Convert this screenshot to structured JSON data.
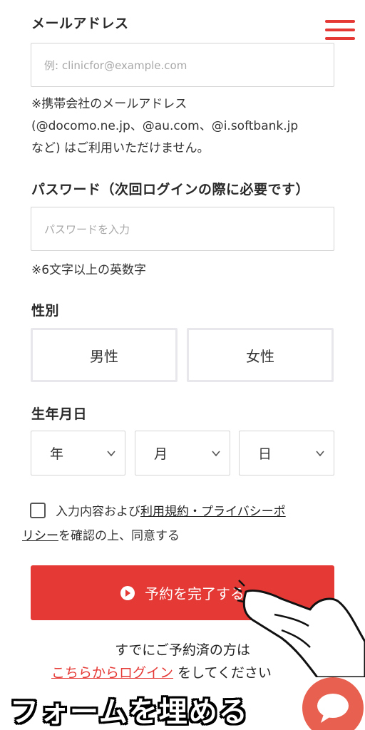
{
  "email": {
    "label": "メールアドレス",
    "placeholder": "例: clinicfor@example.com",
    "note_line1": "※携帯会社のメールアドレス",
    "note_line2": "(@docomo.ne.jp、@au.com、@i.softbank.jp",
    "note_line3": "など) はご利用いただけません。"
  },
  "password": {
    "label": "パスワード（次回ログインの際に必要です）",
    "placeholder": "パスワードを入力",
    "note": "※6文字以上の英数字"
  },
  "gender": {
    "label": "性別",
    "options": [
      "男性",
      "女性"
    ]
  },
  "birthdate": {
    "label": "生年月日",
    "year": "年",
    "month": "月",
    "day": "日"
  },
  "agreement": {
    "prefix": "入力内容および",
    "link_part1": "利用規約・プライバシーポ",
    "link_part2": "リシー",
    "suffix": "を確認の上、同意する"
  },
  "submit": {
    "label": "予約を完了する"
  },
  "login": {
    "line1": "すでにご予約済の方は",
    "link": "こちらからログイン",
    "suffix": "をしてください"
  },
  "overlay": {
    "caption": "フォームを埋める"
  },
  "colors": {
    "accent": "#e53935",
    "chat": "#e8604f"
  },
  "icons": [
    "menu-icon",
    "chevron-down-icon",
    "play-circle-icon",
    "chat-bubble-icon",
    "pointing-hand-icon"
  ]
}
